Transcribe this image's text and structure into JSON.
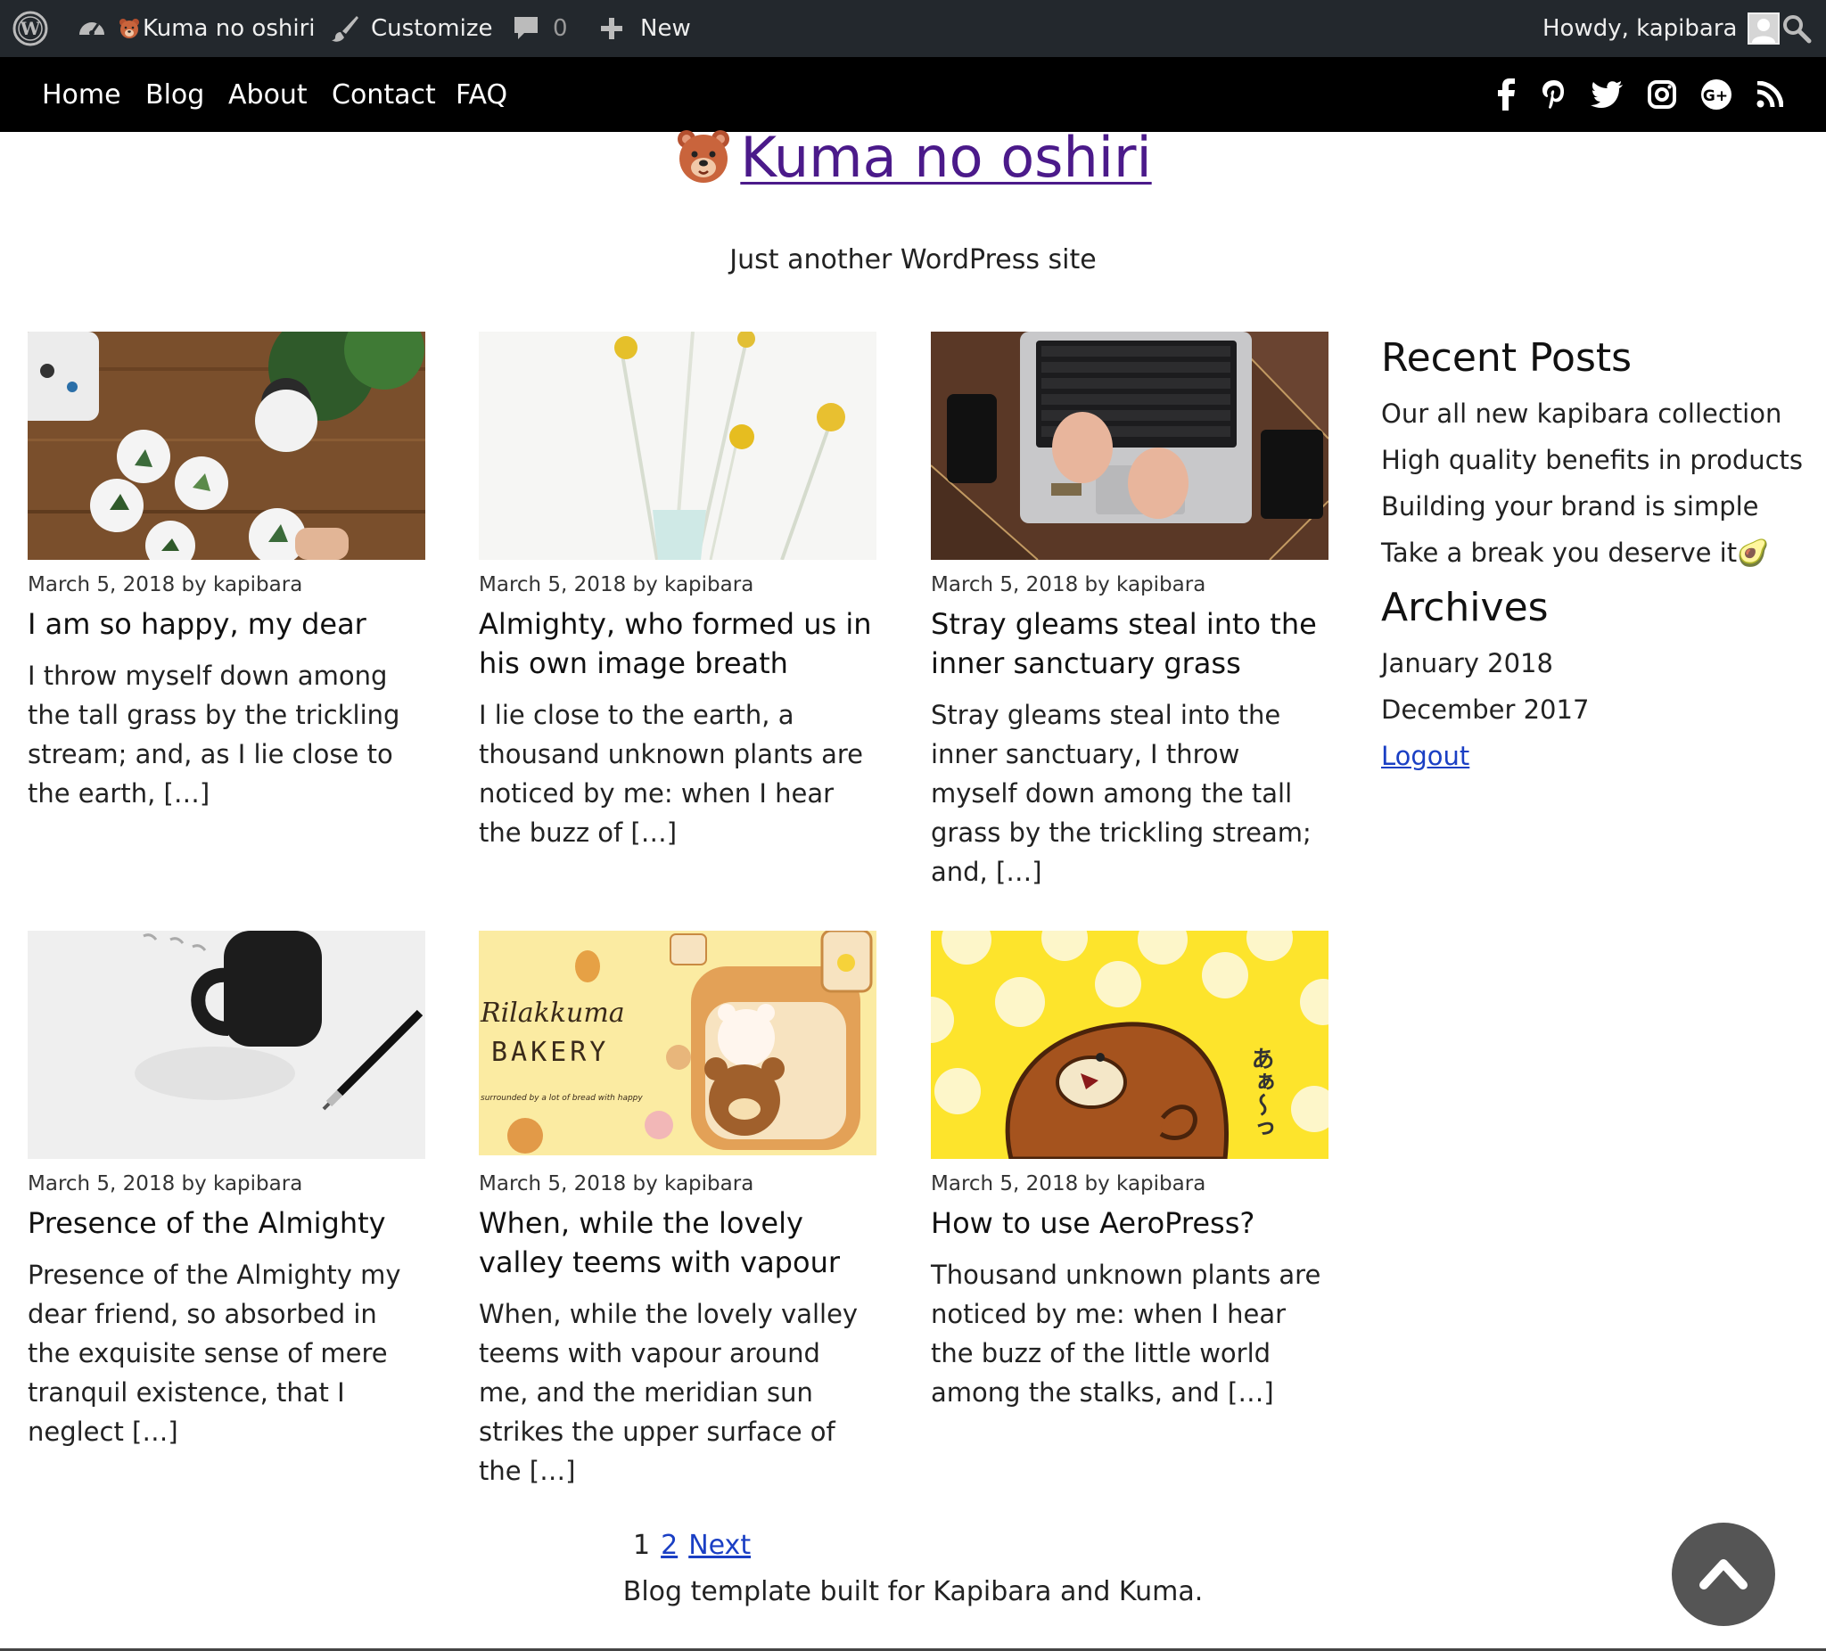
{
  "admin_bar": {
    "site_name": "Kuma no oshiri",
    "customize_label": "Customize",
    "comments_count": "0",
    "new_label": "New",
    "howdy": "Howdy, kapibara"
  },
  "nav": {
    "items": [
      "Home",
      "Blog",
      "About",
      "Contact",
      "FAQ"
    ],
    "social": [
      "facebook-icon",
      "pinterest-icon",
      "twitter-icon",
      "instagram-icon",
      "google-plus-icon",
      "rss-icon"
    ]
  },
  "site": {
    "title": "Kuma no oshiri",
    "tagline": "Just another WordPress site"
  },
  "posts": [
    {
      "meta": "March 5, 2018 by kapibara",
      "title": "I am so happy, my dear",
      "excerpt": "I throw myself down among the tall grass by the trickling stream; and, as I lie close to the earth, […]"
    },
    {
      "meta": "March 5, 2018 by kapibara",
      "title": "Almighty, who formed us in his own image breath",
      "excerpt": "I lie close to the earth, a thousand unknown plants are noticed by me: when I hear the buzz of […]"
    },
    {
      "meta": "March 5, 2018 by kapibara",
      "title": "Stray gleams steal into the inner sanctuary grass",
      "excerpt": "Stray gleams steal into the inner sanctuary, I throw myself down among the tall grass by the trickling stream; and, […]"
    },
    {
      "meta": "March 5, 2018 by kapibara",
      "title": "Presence of the Almighty",
      "excerpt": "Presence of the Almighty my dear friend, so absorbed in the exquisite sense of mere tranquil existence, that I neglect […]"
    },
    {
      "meta": "March 5, 2018 by kapibara",
      "title": "When, while the lovely valley teems with vapour",
      "excerpt": "When, while the lovely valley teems with vapour around me, and the meridian sun strikes the upper surface of the […]"
    },
    {
      "meta": "March 5, 2018 by kapibara",
      "title": "How to use AeroPress?",
      "excerpt": "Thousand unknown plants are noticed by me: when I hear the buzz of the little world among the stalks, and […]"
    }
  ],
  "thumb_text": {
    "bakery_brand": "Rilakkuma",
    "bakery_word": "BAKERY",
    "bakery_small": "surrounded by a lot of bread with happy",
    "aa": "あぁ〜っ"
  },
  "sidebar": {
    "recent_heading": "Recent Posts",
    "recent": [
      "Our all new kapibara collection",
      "High quality benefits in products",
      "Building your brand is simple",
      "Take a break you deserve it🥑"
    ],
    "archives_heading": "Archives",
    "archives": [
      "January 2018",
      "December 2017"
    ],
    "logout": "Logout"
  },
  "pagination": {
    "current": "1",
    "page2": "2",
    "next": "Next"
  },
  "footer": {
    "text": "Blog template built for Kapibara and Kuma."
  },
  "colors": {
    "admin_bar": "#23282d",
    "nav_bar": "#000000",
    "title_link": "#4b1a8a",
    "link": "#1a3fc4"
  }
}
